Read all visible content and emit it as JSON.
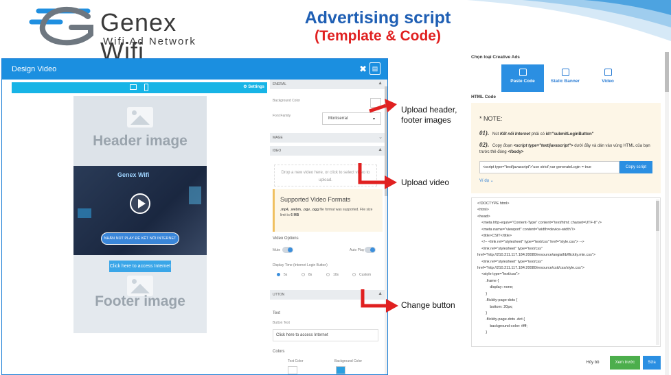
{
  "logo": {
    "name": "Genex Wifi",
    "tagline": "Wifi Ad Network"
  },
  "headline": {
    "title": "Advertising script",
    "subtitle": "(Template & Code)"
  },
  "design": {
    "title": "Design Video",
    "close": "✖",
    "preview": {
      "settings_label": "Settings",
      "header_label": "Header image",
      "footer_label": "Footer image",
      "video_logo": "Genex Wifi",
      "video_button": "NHẤN NÚT PLAY ĐỂ KẾT NỐI INTERNET",
      "access_button": "Click here to access Internet"
    },
    "settings": {
      "general": "ENERAL",
      "background_color": "Background Color",
      "font_family": "Font Family",
      "font_value": "Montserrat",
      "image": "MAGE",
      "video": "IDEO",
      "dropzone": "Drop a new video here, or click to select video to upload.",
      "supported_title": "Supported Video Formats",
      "supported_desc_formats": ".mp4, .webm, .ogv, .ogg",
      "supported_desc_text": " file format was supported. File size limit is ",
      "supported_desc_limit": "6 MB",
      "video_options": "Video Options",
      "mute": "Mute",
      "autoplay": "Auto Play",
      "display_time": "Display Time (Internet Login Button)",
      "times": [
        "5s",
        "8s",
        "10s",
        "Custom"
      ],
      "button_section": "UTTON",
      "text_heading": "Text",
      "button_text_label": "Button Text",
      "button_text_value": "Click here to access Internet",
      "colors": "Colors",
      "text_color": "Text Color",
      "background_color_btn": "Background Color"
    }
  },
  "annotations": {
    "upload_header_1": "Upload header,",
    "upload_header_2": "footer images",
    "upload_video": "Upload video",
    "change_button": "Change button"
  },
  "creative": {
    "title": "Chọn loại Creative Ads",
    "tabs": [
      {
        "label": "Paste Code",
        "active": true
      },
      {
        "label": "Static Banner",
        "active": false
      },
      {
        "label": "Video",
        "active": false
      }
    ],
    "html_code_label": "HTML Code",
    "note_title": "* NOTE:",
    "note_1_num": "01).",
    "note_1_a": "Nút ",
    "note_1_b": "Kết nối Internet",
    "note_1_c": " phải có ",
    "note_1_d": "id=\"submitLoginButton\"",
    "note_2_num": "02).",
    "note_2_a": "Copy đoạn ",
    "note_2_b": "<script type=\"text/javascript\">",
    "note_2_c": " dưới đây và dán vào vùng HTML của bạn trước thẻ đóng ",
    "note_2_d": "</body>",
    "code_snippet": "<script type=\"text/javascript\">'use strict';var generateLogin = true",
    "copy_button": "Copy script",
    "example": "Ví dụ ⌄",
    "code_lines": [
      "<!DOCTYPE html>",
      "<html>",
      "<head>",
      "    <meta http-equiv=\"Content-Type\" content=\"text/html; charset=UTF-8\" />",
      "    <meta name=\"viewport\" content=\"width=device-width\"/>",
      "    <title>CSIT</title>",
      "    <!-- <link rel=\"stylesheet\" type=\"text/css\" href=\"style.css\"> -->",
      "    <link rel=\"stylesheet\" type=\"text/css\"",
      "href=\"http://210.211.117.184:20080/resource/angia/lib/flickity.min.css\">",
      "    <link rel=\"stylesheet\" type=\"text/css\"",
      "href=\"http://210.211.117.184:20080/resource/csit/css/style.css\">",
      "    <style type=\"text/css\">",
      "        .frame {",
      "            display: none;",
      "        }",
      "        .flickity-page-dots {",
      "            bottom: 20px;",
      "        }",
      "        .flickity-page-dots .dot {",
      "            background-color: #fff;",
      "        }"
    ],
    "cancel": "Hủy bỏ",
    "preview": "Xem trước",
    "save": "Sửa"
  },
  "colors": {
    "brand_blue": "#1f5fb4",
    "accent_red": "#e02020",
    "panel_blue": "#1b8fe0",
    "green": "#4cae4c"
  }
}
